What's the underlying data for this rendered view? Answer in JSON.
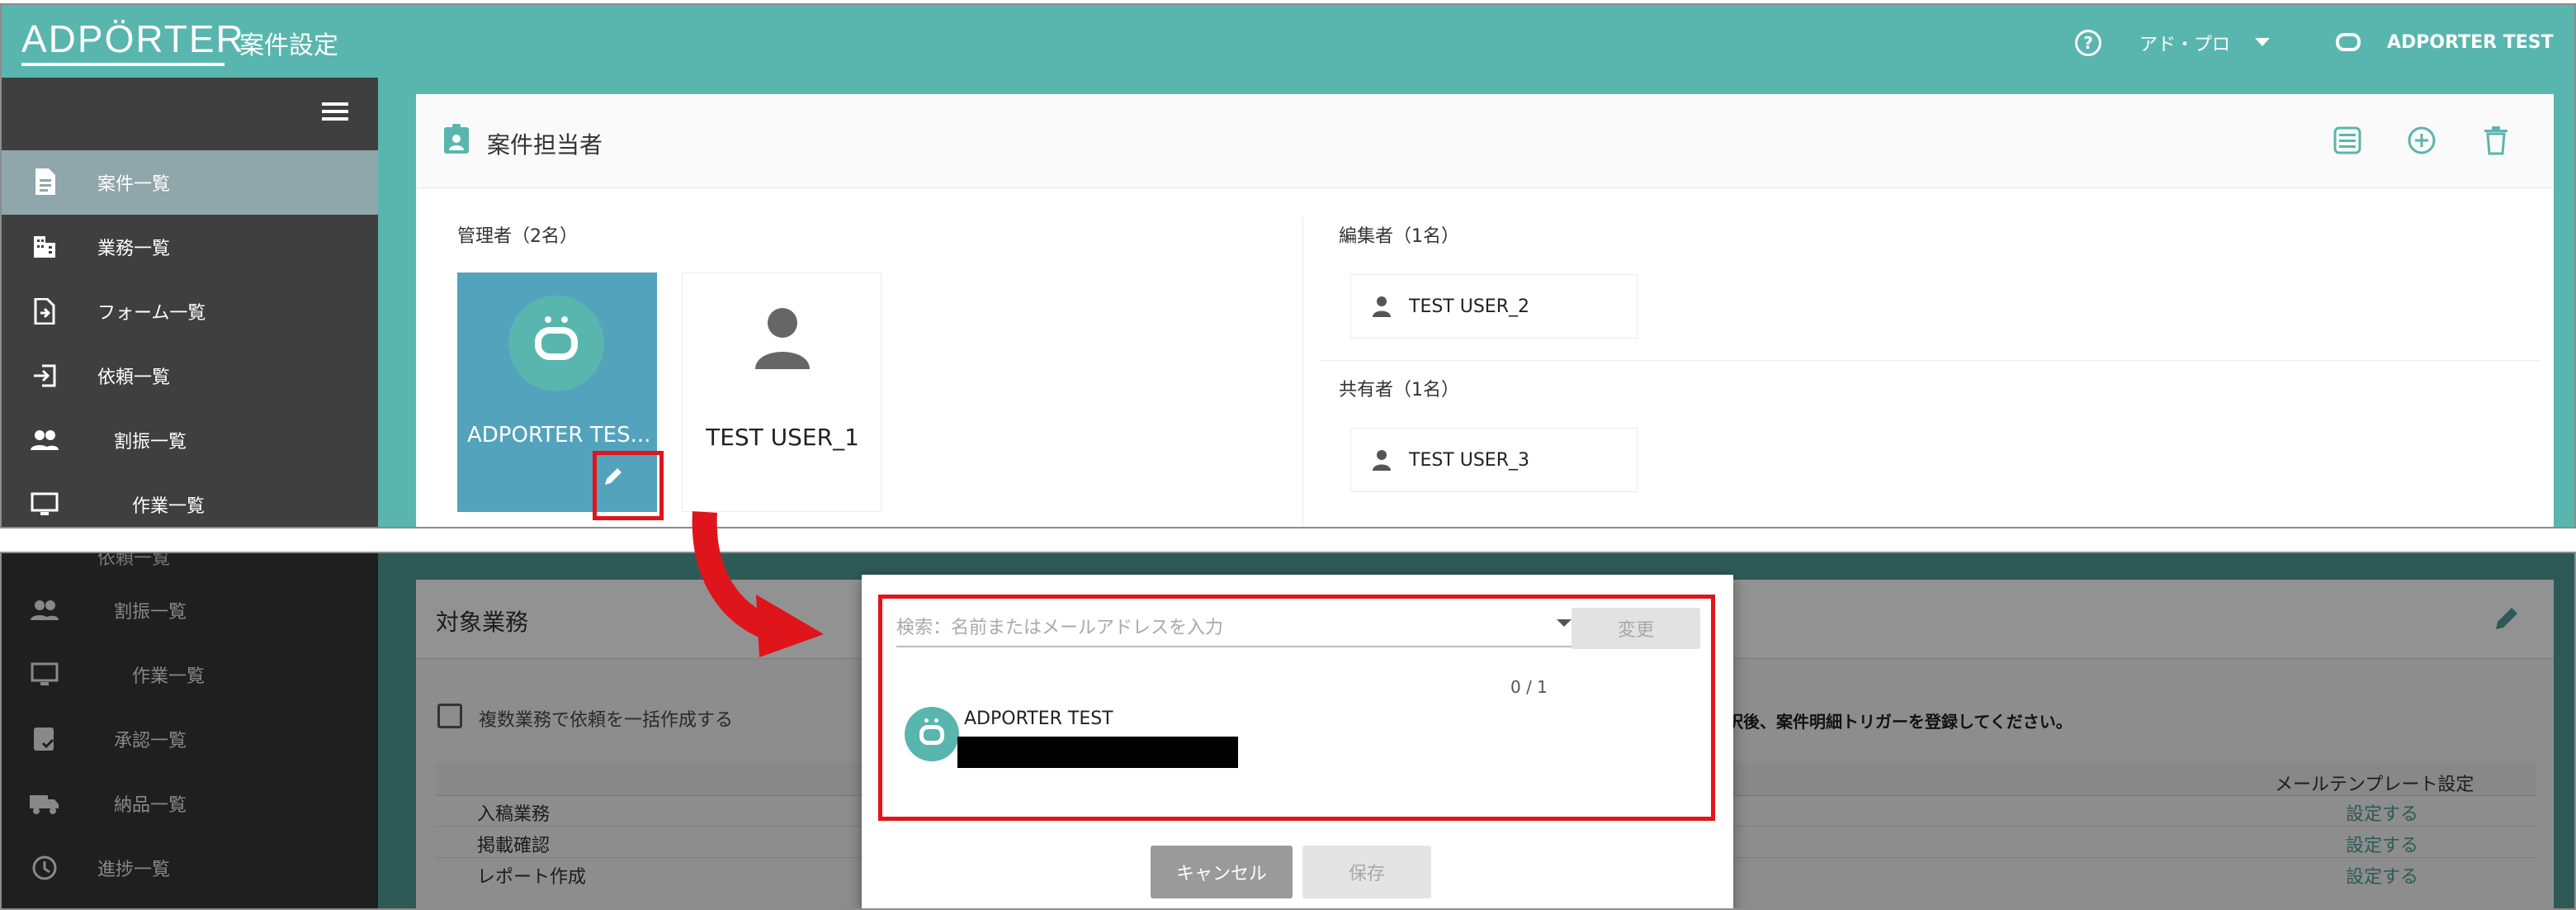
{
  "header": {
    "logo": "ADPÖRTER",
    "page_title": "案件設定",
    "help_icon": "help-icon",
    "org_selector": "アド・プロ",
    "user_name": "ADPORTER TEST"
  },
  "sidebar_top": {
    "items": [
      {
        "label": "案件一覧",
        "icon": "document-icon",
        "active": true
      },
      {
        "label": "業務一覧",
        "icon": "building-icon"
      },
      {
        "label": "フォーム一覧",
        "icon": "file-import-icon"
      },
      {
        "label": "依頼一覧",
        "icon": "login-icon"
      },
      {
        "label": "割振一覧",
        "icon": "people-icon"
      },
      {
        "label": "作業一覧",
        "icon": "monitor-icon"
      }
    ]
  },
  "assignees": {
    "title": "案件担当者",
    "managers_label": "管理者（2名）",
    "managers": [
      {
        "name": "ADPORTER TES..."
      },
      {
        "name": "TEST USER_1"
      }
    ],
    "editors_label": "編集者（1名）",
    "editors": [
      {
        "name": "TEST USER_2"
      }
    ],
    "sharers_label": "共有者（1名）",
    "sharers": [
      {
        "name": "TEST USER_3"
      }
    ]
  },
  "sidebar_bottom": {
    "partial_item": "依頼一覧",
    "items": [
      {
        "label": "割振一覧"
      },
      {
        "label": "作業一覧"
      },
      {
        "label": "承認一覧"
      },
      {
        "label": "納品一覧"
      },
      {
        "label": "進捗一覧"
      }
    ]
  },
  "target_work": {
    "title": "対象業務",
    "bulk_checkbox_label": "複数業務で依頼を一括作成する",
    "notice_fragment": "択後、案件明細トリガーを登録してください。",
    "mail_template_header": "メールテンプレート設定",
    "rows": [
      {
        "name": "入稿業務",
        "action": "設定する"
      },
      {
        "name": "掲載確認",
        "action": "設定する"
      },
      {
        "name": "レポート作成",
        "action": "設定する"
      }
    ]
  },
  "dialog": {
    "search_placeholder": "検索：名前またはメールアドレスを入力",
    "change_button": "変更",
    "counter": "0 / 1",
    "result_name": "ADPORTER TEST",
    "cancel_button": "キャンセル",
    "save_button": "保存"
  },
  "colors": {
    "teal": "#59b6ae",
    "sidebar": "#3f3f3f",
    "active_item": "#8fa6ab",
    "highlight": "#e0141b",
    "manager_tile": "#53a3bd"
  }
}
